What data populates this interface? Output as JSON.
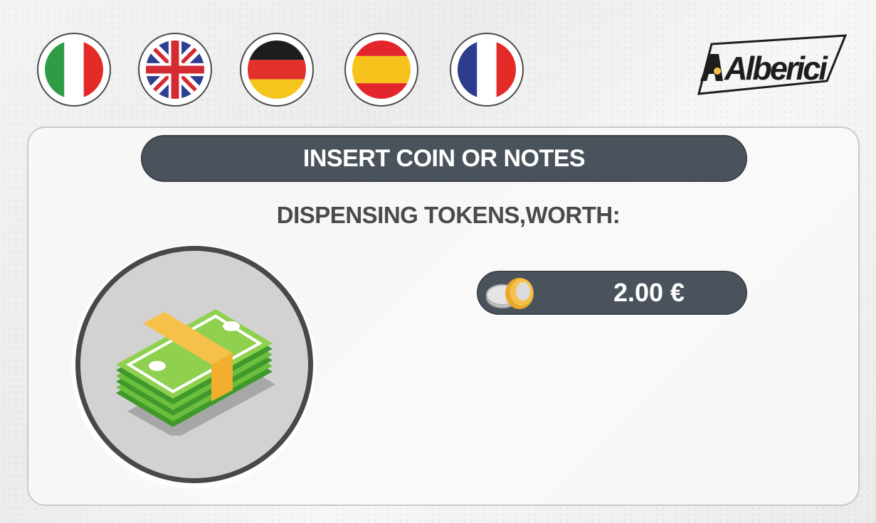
{
  "languages": [
    {
      "code": "it",
      "icon": "italy-flag-icon"
    },
    {
      "code": "en",
      "icon": "uk-flag-icon"
    },
    {
      "code": "de",
      "icon": "germany-flag-icon"
    },
    {
      "code": "es",
      "icon": "spain-flag-icon"
    },
    {
      "code": "fr",
      "icon": "france-flag-icon"
    }
  ],
  "brand": {
    "logo_text": "Alberici",
    "icon": "alberici-logo"
  },
  "panel": {
    "title": "INSERT COIN OR NOTES",
    "subtitle": "DISPENSING TOKENS,WORTH:",
    "payment_icon": "banknotes-stack-icon",
    "token": {
      "icon": "coins-icon",
      "value": "2.00 €"
    }
  },
  "colors": {
    "bar": "#4a535b",
    "text_dark": "#4a4a4a",
    "note_green": "#6cbf3c",
    "band_yellow": "#f6c14b",
    "coin_gold": "#e6a92a"
  }
}
